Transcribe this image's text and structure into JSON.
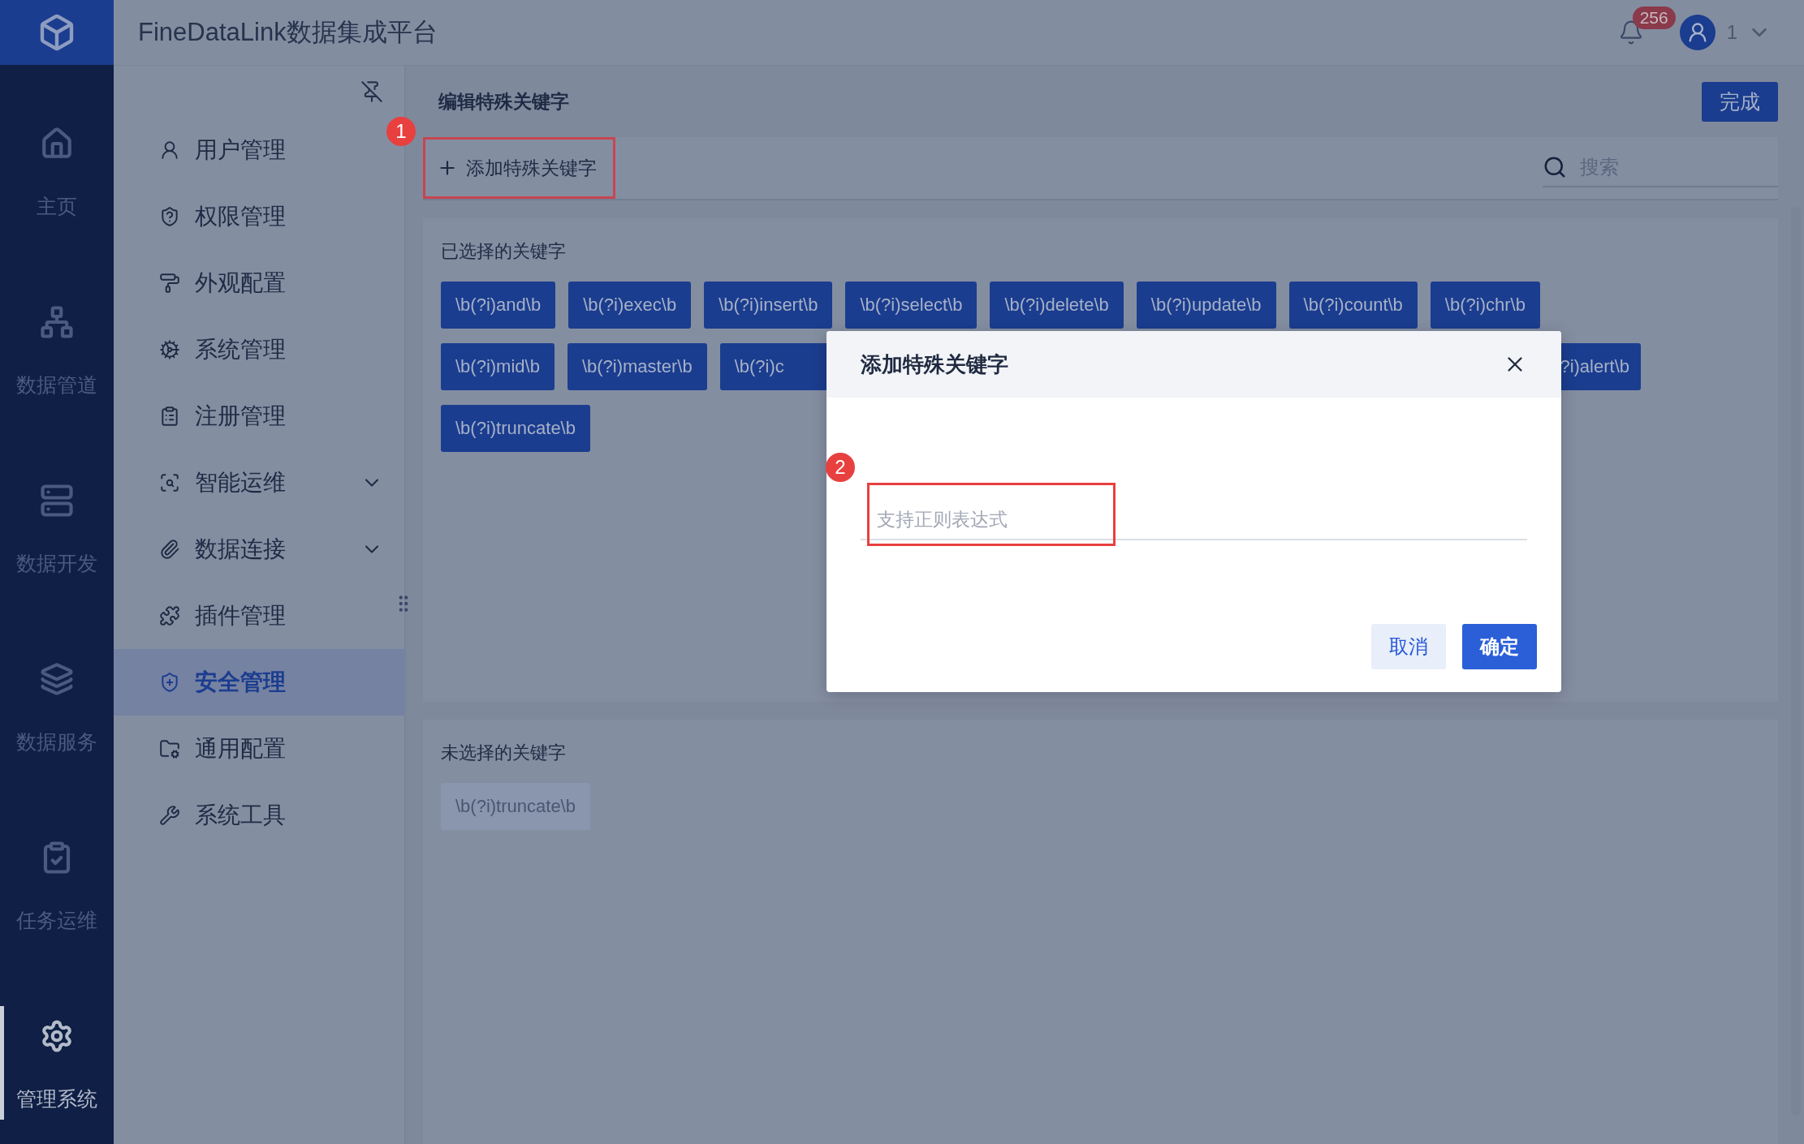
{
  "app": {
    "title": "FineDataLink数据集成平台",
    "notifications": "256",
    "user": "1"
  },
  "rail": [
    {
      "label": "主页",
      "selected": false
    },
    {
      "label": "数据管道",
      "selected": false
    },
    {
      "label": "数据开发",
      "selected": false
    },
    {
      "label": "数据服务",
      "selected": false
    },
    {
      "label": "任务运维",
      "selected": false
    },
    {
      "label": "管理系统",
      "selected": true
    }
  ],
  "menu": [
    {
      "label": "用户管理",
      "kind": "link",
      "selected": false
    },
    {
      "label": "权限管理",
      "kind": "link",
      "selected": false
    },
    {
      "label": "外观配置",
      "kind": "link",
      "selected": false
    },
    {
      "label": "系统管理",
      "kind": "link",
      "selected": false
    },
    {
      "label": "注册管理",
      "kind": "link",
      "selected": false
    },
    {
      "label": "智能运维",
      "kind": "group",
      "selected": false
    },
    {
      "label": "数据连接",
      "kind": "group",
      "selected": false
    },
    {
      "label": "插件管理",
      "kind": "link",
      "selected": false
    },
    {
      "label": "安全管理",
      "kind": "link",
      "selected": true
    },
    {
      "label": "通用配置",
      "kind": "link",
      "selected": false
    },
    {
      "label": "系统工具",
      "kind": "link",
      "selected": false
    }
  ],
  "page": {
    "title": "编辑特殊关键字",
    "done": "完成",
    "add": "添加特殊关键字",
    "search_placeholder": "搜索"
  },
  "selected_keywords": {
    "label": "已选择的关键字",
    "rows": [
      [
        {
          "text": "\\b(?i)and\\b",
          "kind": "whole"
        },
        {
          "text": "\\b(?i)exec\\b",
          "kind": "whole"
        },
        {
          "text": "\\b(?i)insert\\b",
          "kind": "whole"
        },
        {
          "text": "\\b(?i)select\\b",
          "kind": "whole"
        },
        {
          "text": "\\b(?i)delete\\b",
          "kind": "whole"
        },
        {
          "text": "\\b(?i)update\\b",
          "kind": "whole"
        },
        {
          "text": "\\b(?i)count\\b",
          "kind": "whole"
        },
        {
          "text": "\\b(?i)chr\\b",
          "kind": "whole"
        }
      ],
      [
        {
          "text": "\\b(?i)mid\\b",
          "kind": "whole"
        },
        {
          "text": "\\b(?i)master\\b",
          "kind": "whole"
        },
        {
          "text": "\\b(?i)c",
          "kind": "cut_right"
        },
        {
          "text": "?i)alert\\b",
          "kind": "cut_left"
        }
      ],
      [
        {
          "text": "\\b(?i)truncate\\b",
          "kind": "whole"
        }
      ]
    ]
  },
  "unselected_keywords": {
    "label": "未选择的关键字",
    "chips": [
      {
        "text": "\\b(?i)truncate\\b",
        "disabled": true
      }
    ]
  },
  "dialog": {
    "title": "添加特殊关键字",
    "placeholder": "支持正则表达式",
    "cancel": "取消",
    "confirm": "确定"
  },
  "annotations": [
    {
      "label": "1"
    },
    {
      "label": "2"
    }
  ]
}
